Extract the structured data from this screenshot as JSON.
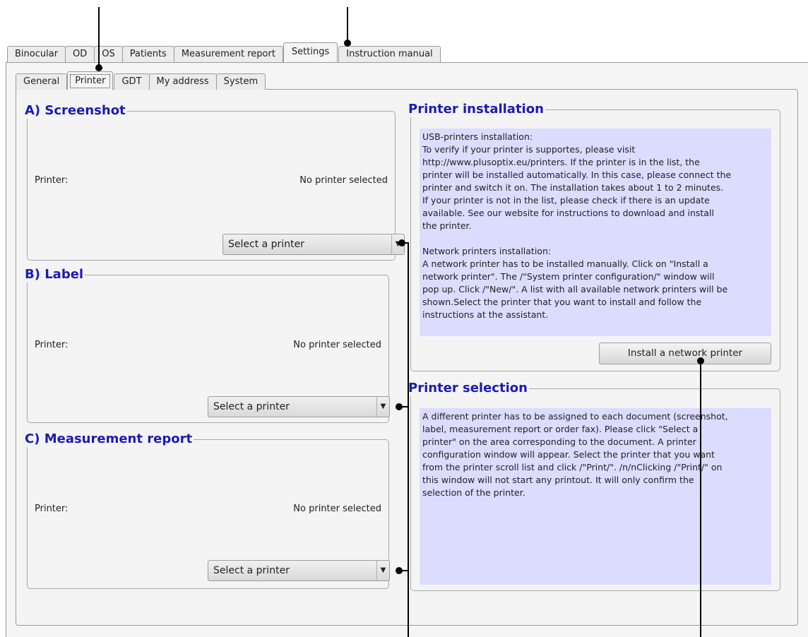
{
  "main_tabs": [
    {
      "label": "Binocular"
    },
    {
      "label": "OD"
    },
    {
      "label": "OS"
    },
    {
      "label": "Patients"
    },
    {
      "label": "Measurement report"
    },
    {
      "label": "Settings",
      "active": true
    },
    {
      "label": "Instruction manual"
    }
  ],
  "sub_tabs": [
    {
      "label": "General"
    },
    {
      "label": "Printer",
      "active": true
    },
    {
      "label": "GDT"
    },
    {
      "label": "My address"
    },
    {
      "label": "System"
    }
  ],
  "screenshot": {
    "title": "A) Screenshot",
    "printer_label": "Printer:",
    "printer_value": "No printer selected",
    "select_label": "Select a printer"
  },
  "label": {
    "title": "B) Label",
    "printer_label": "Printer:",
    "printer_value": "No printer selected",
    "select_label": "Select a printer"
  },
  "report": {
    "title": "C) Measurement report",
    "printer_label": "Printer:",
    "printer_value": "No printer selected",
    "select_label": "Select a printer"
  },
  "installation": {
    "title": "Printer installation",
    "text": "USB-printers installation:\nTo verify if your printer is supportes, please visit\nhttp://www.plusoptix.eu/printers. If the printer is in the list, the\nprinter will be installed automatically. In this case, please connect the\nprinter and switch it on. The installation takes about 1 to 2 minutes.\nIf your printer is not in the list, please check if there is an update\navailable. See our website for instructions to download and install\nthe printer.\n\nNetwork printers installation:\nA network printer has to be installed manually. Click on \"Install a\nnetwork printer\". The /\"System printer configuration/\" window will\npop up. Click /\"New/\". A list with all available network printers will be\nshown.Select the printer that you want to install and follow the\ninstructions at the assistant.",
    "button_label": "Install a network printer"
  },
  "selection": {
    "title": "Printer selection",
    "text": "A different printer has to be assigned to each document (screenshot,\nlabel, measurement report or order fax). Please click \"Select a\nprinter\" on the area corresponding to the document. A printer\nconfiguration window will appear. Select the printer that you want\nfrom the printer scroll list and click /\"Print/\". /n/nClicking /\"Print/\" on\nthis window will not start any printout. It will only confirm the\nselection of the printer."
  },
  "icons": {
    "dropdown": "dropdown-arrow-icon"
  }
}
